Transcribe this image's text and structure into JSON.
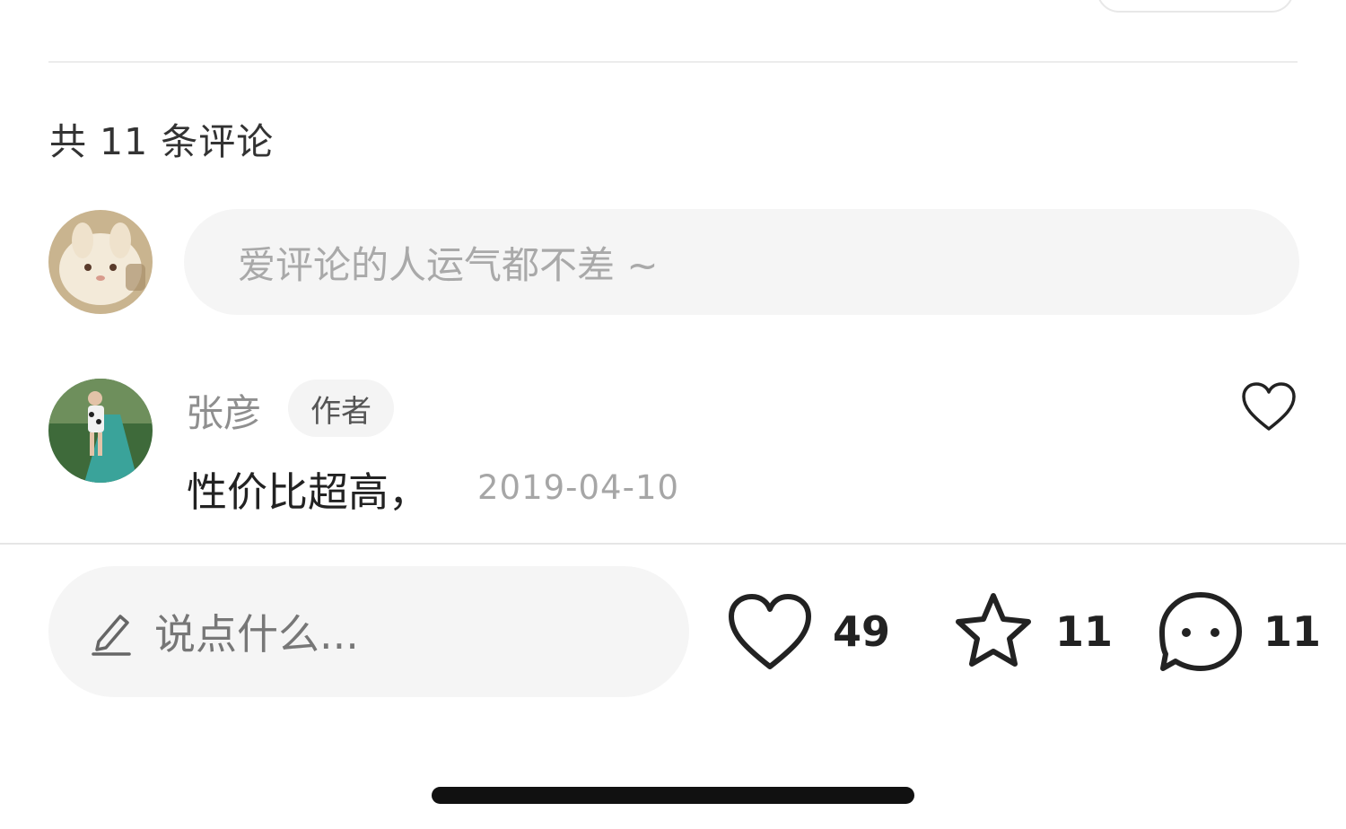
{
  "comments_header": {
    "count_label": "共 11 条评论"
  },
  "comment_box": {
    "placeholder": "爱评论的人运气都不差 ~"
  },
  "comments": [
    {
      "author": "张彦",
      "badge": "作者",
      "text": "性价比超高，",
      "date": "2019-04-10"
    }
  ],
  "bottom_bar": {
    "input_placeholder": "说点什么...",
    "likes": "49",
    "favorites": "11",
    "comments": "11"
  },
  "icons": {
    "pencil": "pencil-icon",
    "heart": "heart-icon",
    "star": "star-icon",
    "chat": "chat-bubble-icon"
  },
  "colors": {
    "input_bg": "#f5f5f5",
    "placeholder_text": "#a9a9a9",
    "date_text": "#a6a6a6",
    "icon_stroke": "#222222"
  }
}
